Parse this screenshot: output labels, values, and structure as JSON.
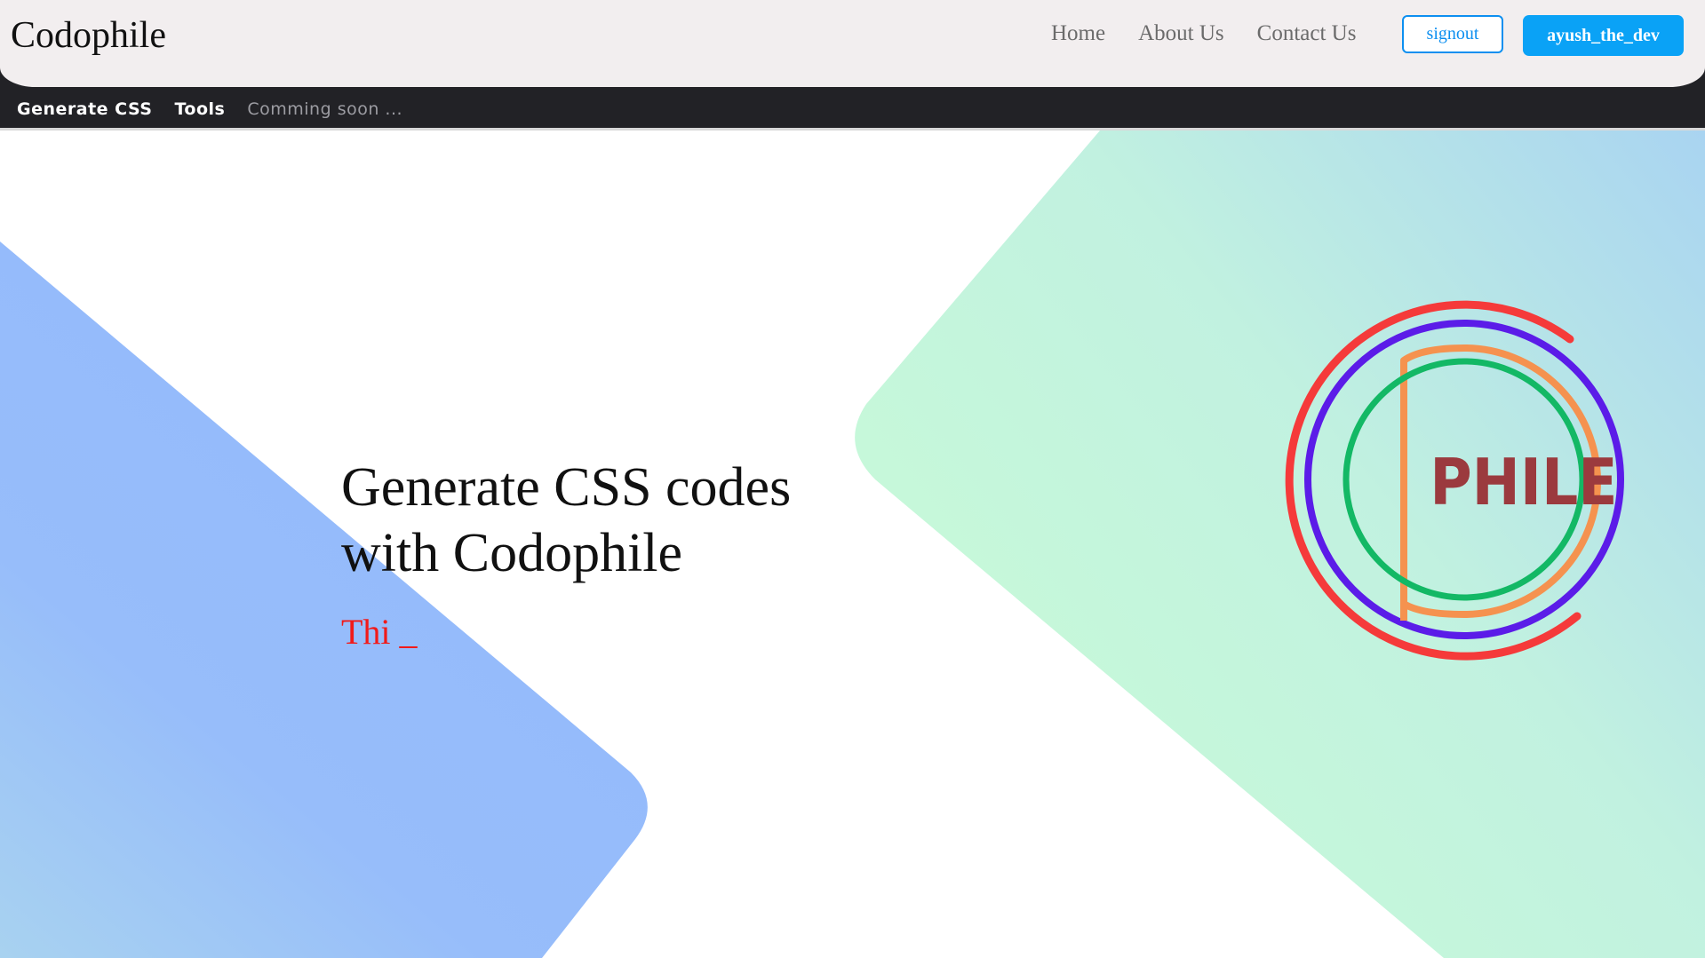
{
  "header": {
    "brand": "Codophile",
    "nav": [
      "Home",
      "About Us",
      "Contact Us"
    ],
    "signout_label": "signout",
    "user_label": "ayush_the_dev"
  },
  "subnav": {
    "items": [
      "Generate CSS",
      "Tools"
    ],
    "coming_soon": "Comming soon ..."
  },
  "hero": {
    "title": "Generate CSS codes with Codophile",
    "typing_text": "Thi _"
  },
  "logo": {
    "text": "PHILE",
    "ring_colors": [
      "#f53a3a",
      "#5b1ce8",
      "#f5924f",
      "#13b865"
    ],
    "text_color": "#9b3a3e"
  },
  "colors": {
    "accent": "#0aa2f6",
    "left_shape": "#94bcfb",
    "right_shape_from": "#c9fbd8",
    "right_shape_to": "#a7d4f0",
    "typing": "#f11a1a"
  }
}
